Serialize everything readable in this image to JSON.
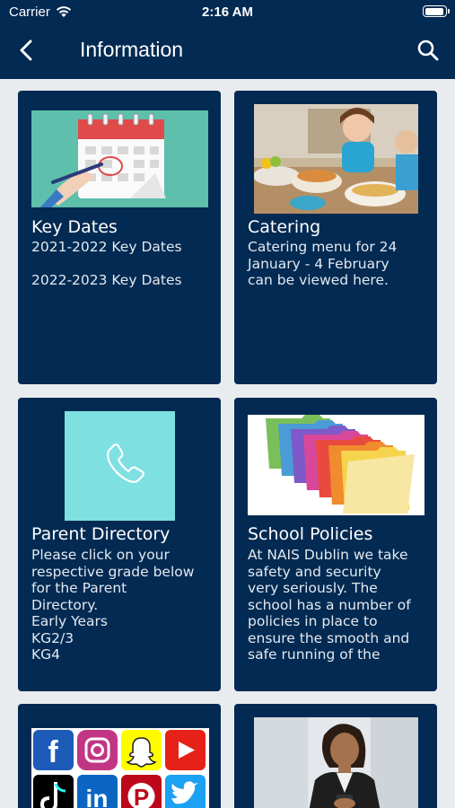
{
  "status_bar": {
    "carrier": "Carrier",
    "time": "2:16 AM"
  },
  "header": {
    "title": "Information"
  },
  "cards": [
    {
      "title": "Key Dates",
      "lines": [
        "2021-2022 Key Dates",
        "",
        "2022-2023 Key Dates"
      ]
    },
    {
      "title": "Catering",
      "text": "Catering menu for 24\nJanuary - 4 February\ncan be viewed here."
    },
    {
      "title": "Parent Directory",
      "text": "Please click on your\nrespective grade below\nfor the Parent\nDirectory.\nEarly Years\nKG2/3\nKG4"
    },
    {
      "title": "School Policies",
      "text": "At NAIS Dublin we take\nsafety and security\nvery seriously. The\nschool has a number of\npolicies in place to\nensure the smooth and\nsafe running of the"
    },
    {
      "title": ""
    },
    {
      "title": ""
    }
  ],
  "social_icons": [
    "facebook-icon",
    "instagram-icon",
    "snapchat-icon",
    "youtube-icon",
    "tiktok-icon",
    "linkedin-icon",
    "pinterest-icon",
    "twitter-icon"
  ]
}
